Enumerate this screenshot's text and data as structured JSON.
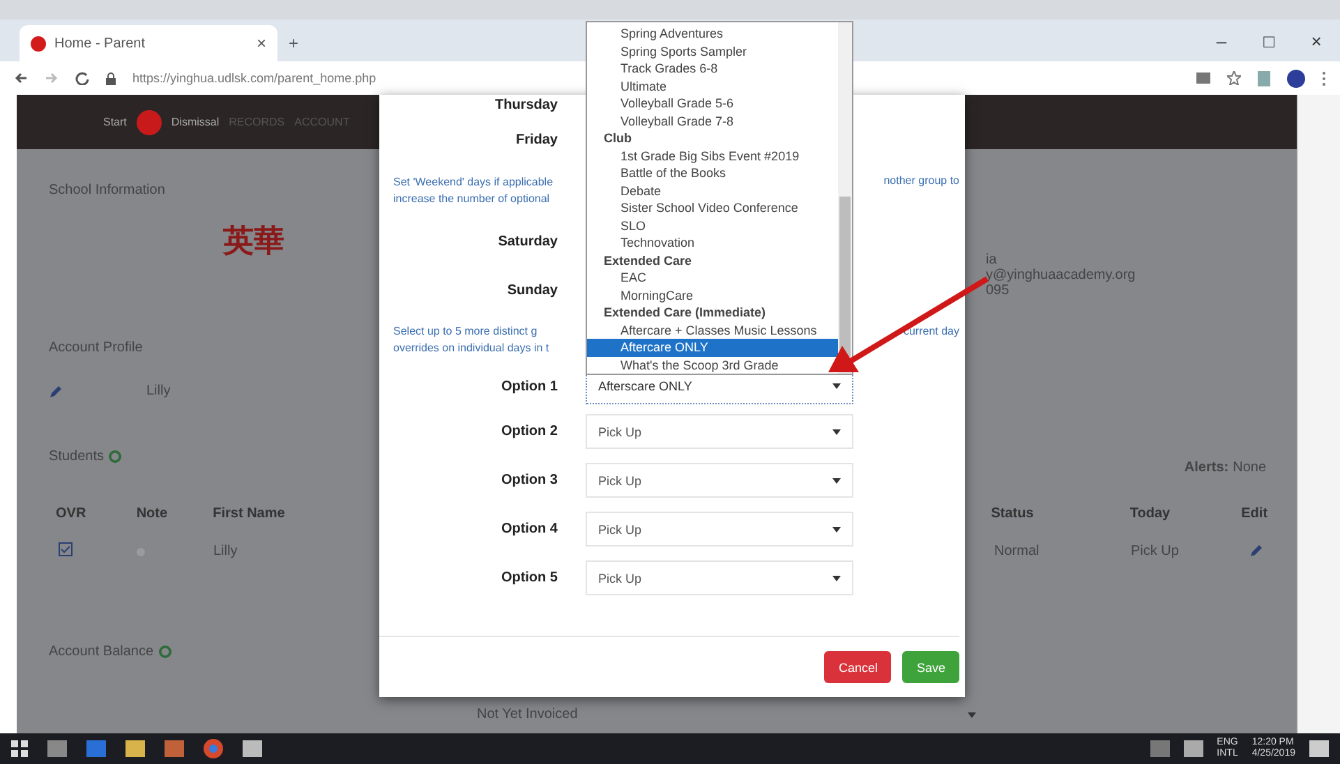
{
  "browser": {
    "tab_title": "Home - Parent",
    "tab_close": "×",
    "new_tab": "+",
    "url": "https://yinghua.udlsk.com/parent_home.php",
    "window_controls": [
      "–",
      "□",
      "×"
    ]
  },
  "navbar": {
    "items": [
      "Start",
      "Dismissal",
      "RECORDS",
      "ACCOUNT"
    ]
  },
  "page": {
    "school_heading": "School Information",
    "school_logo": "英華",
    "contact_fragments": [
      "ia",
      "y@yinghuaacademy.org",
      "095"
    ],
    "profile_heading": "Account Profile",
    "profile_name": "Lilly",
    "alerts_label": "Alerts:",
    "alerts_value": "None",
    "students_heading": "Students",
    "students_columns": [
      "OVR",
      "Note",
      "First Name",
      "Status",
      "Today",
      "Edit"
    ],
    "students_rows": [
      {
        "ovr_checked": true,
        "first_name": "Lilly",
        "status": "Normal",
        "today": "Pick Up"
      }
    ],
    "balance_heading": "Account Balance",
    "invoice_filter": "Not Yet Invoiced"
  },
  "modal": {
    "days": [
      "Thursday",
      "Friday"
    ],
    "weekend_note": {
      "left": [
        "Set 'Weekend' days if applicable",
        "increase the number of optional"
      ],
      "right": "nother group to"
    },
    "weekend_days": [
      "Saturday",
      "Sunday"
    ],
    "select_note": {
      "left": [
        "Select up to 5 more distinct g",
        "overrides on individual days in t"
      ],
      "right": "current day"
    },
    "options": [
      {
        "label": "Option 1",
        "value": "Afterscare ONLY",
        "focused": true
      },
      {
        "label": "Option 2",
        "value": "Pick Up",
        "focused": false
      },
      {
        "label": "Option 3",
        "value": "Pick Up",
        "focused": false
      },
      {
        "label": "Option 4",
        "value": "Pick Up",
        "focused": false
      },
      {
        "label": "Option 5",
        "value": "Pick Up",
        "focused": false
      }
    ],
    "buttons": [
      {
        "label": "Cancel",
        "kind": "cancel"
      },
      {
        "label": "Save",
        "kind": "save"
      }
    ]
  },
  "dropdown": {
    "items": [
      {
        "label": "Spring Adventures",
        "kind": "option",
        "selected": false
      },
      {
        "label": "Spring Sports Sampler",
        "kind": "option",
        "selected": false
      },
      {
        "label": "Track Grades 6-8",
        "kind": "option",
        "selected": false
      },
      {
        "label": "Ultimate",
        "kind": "option",
        "selected": false
      },
      {
        "label": "Volleyball Grade 5-6",
        "kind": "option",
        "selected": false
      },
      {
        "label": "Volleyball Grade 7-8",
        "kind": "option",
        "selected": false
      },
      {
        "label": "Club",
        "kind": "group",
        "selected": false
      },
      {
        "label": "1st Grade Big Sibs Event #2019",
        "kind": "option",
        "selected": false
      },
      {
        "label": "Battle of the Books",
        "kind": "option",
        "selected": false
      },
      {
        "label": "Debate",
        "kind": "option",
        "selected": false
      },
      {
        "label": "Sister School Video Conference",
        "kind": "option",
        "selected": false
      },
      {
        "label": "SLO",
        "kind": "option",
        "selected": false
      },
      {
        "label": "Technovation",
        "kind": "option",
        "selected": false
      },
      {
        "label": "Extended Care",
        "kind": "group",
        "selected": false
      },
      {
        "label": "EAC",
        "kind": "option",
        "selected": false
      },
      {
        "label": "MorningCare",
        "kind": "option",
        "selected": false
      },
      {
        "label": "Extended Care (Immediate)",
        "kind": "group",
        "selected": false
      },
      {
        "label": "Aftercare + Classes Music Lessons",
        "kind": "option",
        "selected": false
      },
      {
        "label": "Aftercare ONLY",
        "kind": "option",
        "selected": true
      },
      {
        "label": "What's the Scoop 3rd Grade",
        "kind": "option",
        "selected": false
      }
    ]
  },
  "taskbar": {
    "language": [
      "ENG",
      "INTL"
    ],
    "time": "12:20 PM",
    "date": "4/25/2019"
  }
}
